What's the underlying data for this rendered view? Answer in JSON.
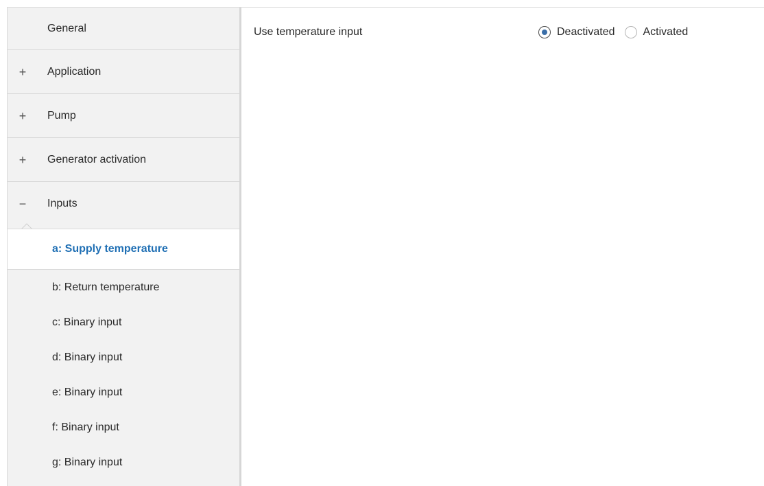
{
  "sidebar": {
    "top_items": [
      {
        "sign": "",
        "label": "General"
      },
      {
        "sign": "+",
        "label": "Application"
      },
      {
        "sign": "+",
        "label": "Pump"
      },
      {
        "sign": "+",
        "label": "Generator activation"
      },
      {
        "sign": "−",
        "label": "Inputs"
      }
    ],
    "sub_items": [
      {
        "label": "a: Supply temperature",
        "selected": true
      },
      {
        "label": "b: Return temperature"
      },
      {
        "label": "c: Binary input"
      },
      {
        "label": "d: Binary input"
      },
      {
        "label": "e: Binary input"
      },
      {
        "label": "f: Binary input"
      },
      {
        "label": "g: Binary input"
      }
    ]
  },
  "main": {
    "parameter": {
      "label": "Use temperature input",
      "options": [
        {
          "label": "Deactivated",
          "checked": true
        },
        {
          "label": "Activated",
          "checked": false
        }
      ]
    }
  },
  "colors": {
    "sidebar_bg": "#f2f2f2",
    "selected_text": "#1f6fb4",
    "radio_dot": "#3a6ea8"
  }
}
